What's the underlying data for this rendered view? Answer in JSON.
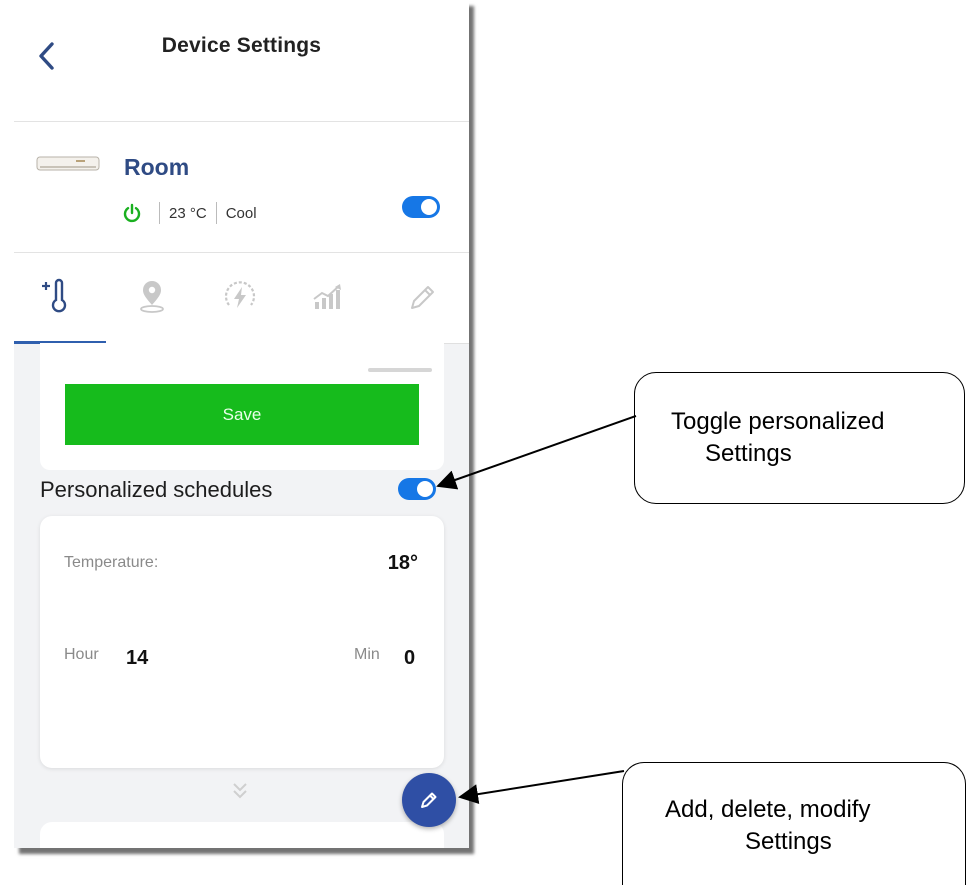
{
  "header": {
    "title": "Device Settings"
  },
  "device": {
    "name": "Room",
    "temperature": "23 °C",
    "mode": "Cool",
    "power_on": true
  },
  "tabs": [
    {
      "icon": "thermometer-plus-icon",
      "active": true
    },
    {
      "icon": "location-pin-icon",
      "active": false
    },
    {
      "icon": "energy-gauge-icon",
      "active": false
    },
    {
      "icon": "growth-chart-icon",
      "active": false
    },
    {
      "icon": "pencil-icon",
      "active": false
    }
  ],
  "save_label": "Save",
  "schedules": {
    "title": "Personalized schedules",
    "enabled": true,
    "temperature_label": "Temperature:",
    "temperature_value": "18°",
    "hour_label": "Hour",
    "hour_value": "14",
    "min_label": "Min",
    "min_value": "0"
  },
  "annotations": {
    "toggle_line1": "Toggle personalized",
    "toggle_line2": "Settings",
    "edit_line1": "Add, delete, modify",
    "edit_line2": "Settings"
  },
  "colors": {
    "accent": "#1677e6",
    "brand": "#2f4b84",
    "save": "#16bb1c",
    "fab": "#2f4fa5",
    "power": "#1ab020"
  }
}
